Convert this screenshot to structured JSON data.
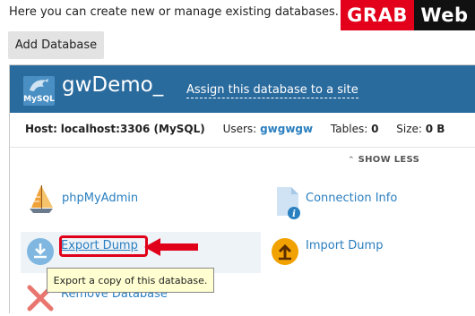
{
  "header": {
    "intro_text": "Here you can create new or manage existing databases.",
    "brand_part1": "GRAB",
    "brand_part2": "Web"
  },
  "toolbar": {
    "add_database_label": "Add Database"
  },
  "database": {
    "logo_text": "MySQL",
    "name": "gwDemo_",
    "assign_link": "Assign this database to a site",
    "host_label": "Host:",
    "host_value": "localhost:3306 (MySQL)",
    "users_label": "Users:",
    "users_value": "gwgwgw",
    "tables_label": "Tables:",
    "tables_value": "0",
    "size_label": "Size:",
    "size_value": "0 B",
    "show_less_label": "SHOW LESS"
  },
  "tools": {
    "phpmyadmin": "phpMyAdmin",
    "connection_info": "Connection Info",
    "export_dump": "Export Dump",
    "import_dump": "Import Dump",
    "remove_database": "Remove Database"
  },
  "tooltip": {
    "text": "Export a copy of this database."
  },
  "colors": {
    "header_blue": "#2a6b9e",
    "link_blue": "#2a7fc0",
    "highlight_red": "#e0001a",
    "tooltip_bg": "#ffffd2"
  }
}
